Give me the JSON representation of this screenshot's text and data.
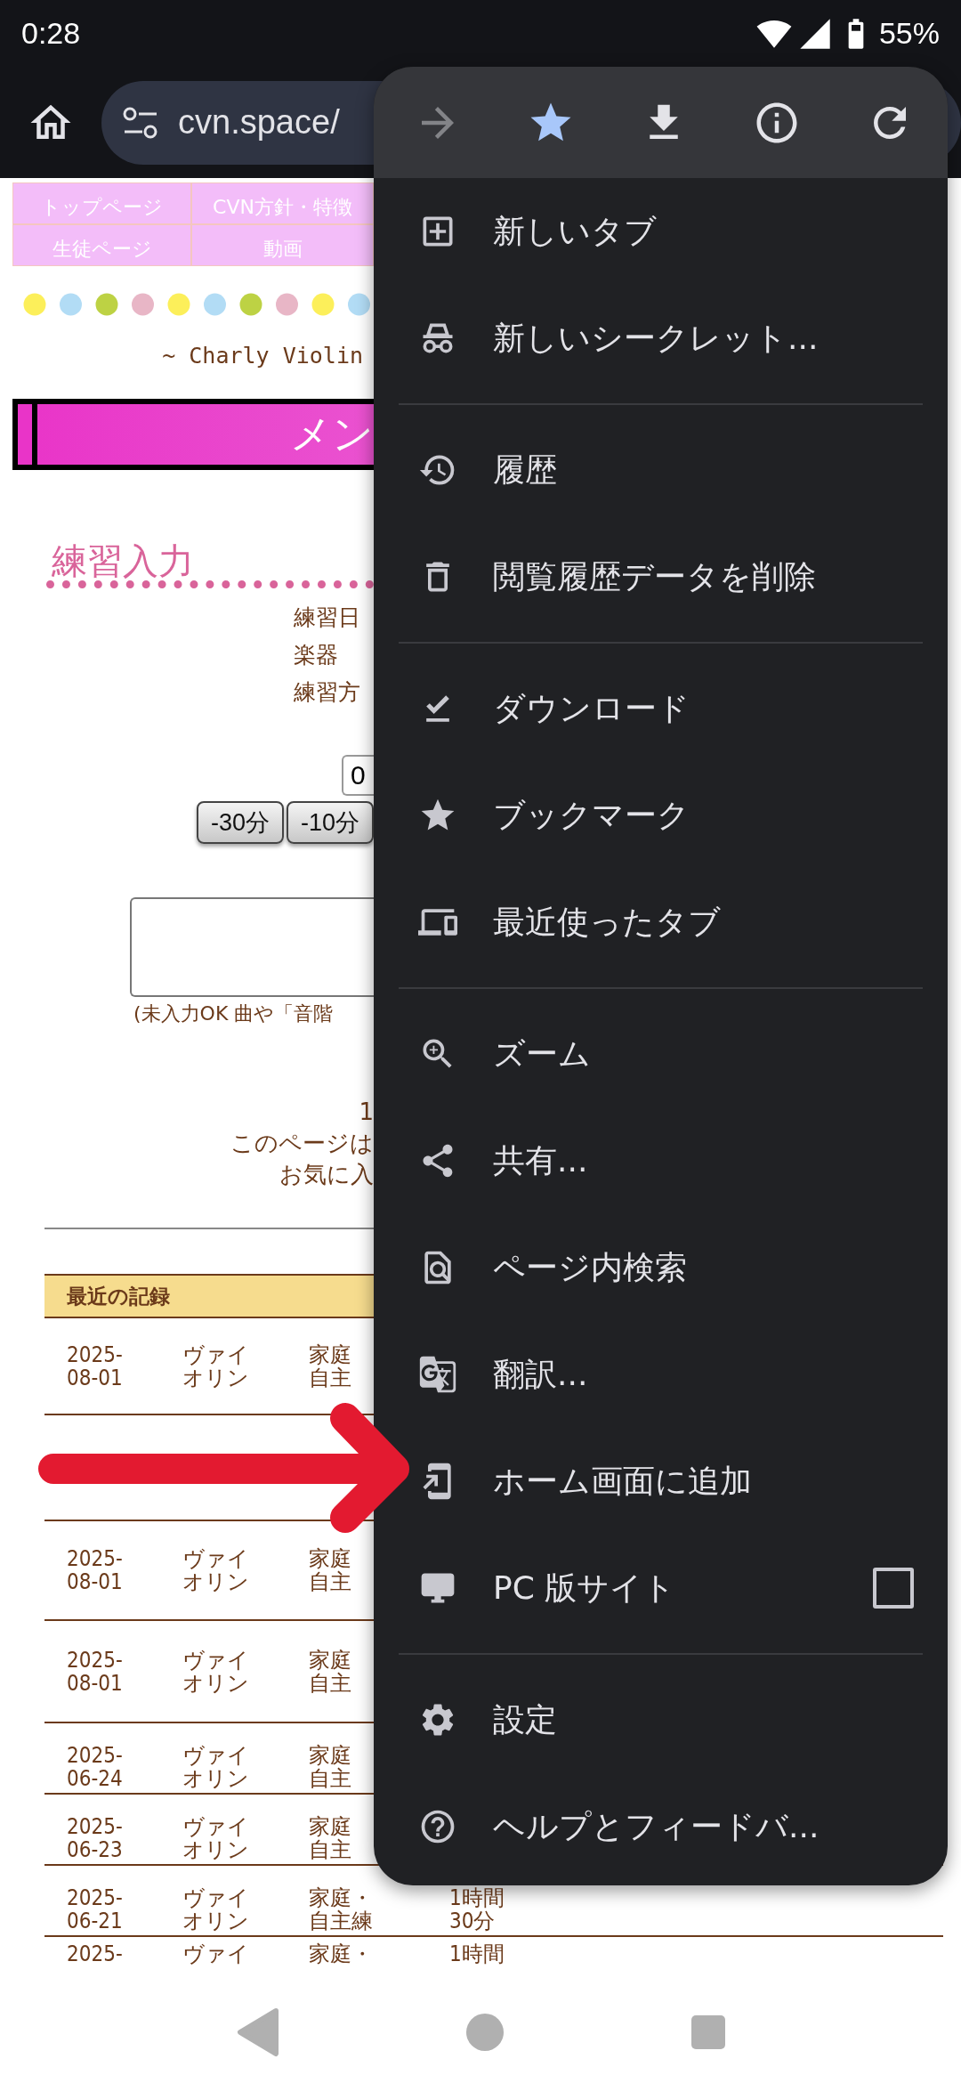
{
  "status_bar": {
    "time": "0:28",
    "battery": "55%"
  },
  "address_bar": {
    "url": "cvn.space/"
  },
  "page": {
    "nav": [
      {
        "label": "トップページ"
      },
      {
        "label": "CVN方針・特徴"
      },
      {
        "label": "生徒ページ"
      },
      {
        "label": "動画"
      }
    ],
    "tagline": "~ Charly Violin",
    "banner": "メン",
    "heading": "練習入力",
    "form_labels": [
      "練習日",
      "楽器",
      "練習方"
    ],
    "duration_input": {
      "value": "0"
    },
    "adjust_buttons": [
      "-30分",
      "-10分"
    ],
    "memo_note": "(未入力OK 曲や「音階",
    "notice_lines": [
      "1",
      "このページは",
      "お気に入"
    ],
    "records": {
      "title": "最近の記録",
      "rows": [
        {
          "date": "2025-\n08-01",
          "instrument": "ヴァイオリン",
          "method": "家庭自主"
        },
        {},
        {
          "date": "2025-\n08-01",
          "instrument": "ヴァイオリン",
          "method": "家庭自主"
        },
        {
          "date": "2025-\n08-01",
          "instrument": "ヴァイオリン",
          "method": "家庭自主"
        },
        {
          "date": "2025-\n06-24",
          "instrument": "ヴァイオリン",
          "method": "家庭自主"
        },
        {
          "date": "2025-\n06-23",
          "instrument": "ヴァイオリン",
          "method": "家庭自主"
        },
        {
          "date": "2025-\n06-21",
          "instrument": "ヴァイオリン",
          "method": "家庭・自主練",
          "time": "1時間30分"
        },
        {
          "date": "2025-",
          "instrument": "ヴァイ",
          "method": "家庭・",
          "time": "1時間"
        }
      ]
    }
  },
  "menu": {
    "toolbar": [
      {
        "kind": "forward",
        "disabled": true,
        "on": false
      },
      {
        "kind": "bookmark",
        "disabled": false,
        "on": true
      },
      {
        "kind": "download",
        "disabled": false,
        "on": false
      },
      {
        "kind": "info",
        "disabled": false,
        "on": false
      },
      {
        "kind": "refresh",
        "disabled": false,
        "on": false
      }
    ],
    "sections": [
      {
        "items": [
          {
            "label": "新しいタブ"
          },
          {
            "label": "新しいシークレット..."
          }
        ]
      },
      {
        "items": [
          {
            "label": "履歴"
          },
          {
            "label": "閲覧履歴データを削除"
          }
        ]
      },
      {
        "items": [
          {
            "label": "ダウンロード"
          },
          {
            "label": "ブックマーク"
          },
          {
            "label": "最近使ったタブ"
          }
        ]
      },
      {
        "items": [
          {
            "label": "ズーム"
          },
          {
            "label": "共有..."
          },
          {
            "label": "ページ内検索"
          },
          {
            "label": "翻訳..."
          },
          {
            "label": "ホーム画面に追加"
          },
          {
            "label": "PC 版サイト",
            "checked": false
          }
        ]
      },
      {
        "items": [
          {
            "label": "設定"
          },
          {
            "label": "ヘルプとフィードバ..."
          }
        ]
      }
    ]
  }
}
